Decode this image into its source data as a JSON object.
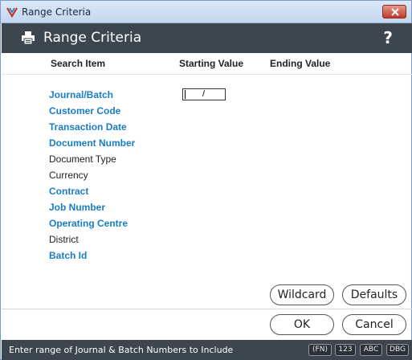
{
  "window": {
    "title": "Range Criteria"
  },
  "header": {
    "title": "Range Criteria",
    "help_glyph": "?"
  },
  "columns": {
    "search_item": "Search Item",
    "starting_value": "Starting Value",
    "ending_value": "Ending Value"
  },
  "fields": [
    {
      "label": "Journal/Batch",
      "link": true
    },
    {
      "label": "Customer Code",
      "link": true
    },
    {
      "label": "Transaction Date",
      "link": true
    },
    {
      "label": "Document Number",
      "link": true
    },
    {
      "label": "Document Type",
      "link": false
    },
    {
      "label": "Currency",
      "link": false
    },
    {
      "label": "Contract",
      "link": true
    },
    {
      "label": "Job Number",
      "link": true
    },
    {
      "label": "Operating Centre",
      "link": true
    },
    {
      "label": "District",
      "link": false
    },
    {
      "label": "Batch Id",
      "link": true
    }
  ],
  "journal_batch_input": {
    "separator": "/"
  },
  "buttons": {
    "wildcard": "Wildcard",
    "defaults": "Defaults",
    "ok": "OK",
    "cancel": "Cancel"
  },
  "status": {
    "message": "Enter range of Journal & Batch Numbers to Include",
    "badges": [
      "(FN)",
      "123",
      "ABC",
      "DBG"
    ]
  },
  "colors": {
    "link_blue": "#1a7dc4",
    "header_bg": "#3d454e",
    "close_red": "#c0392b"
  }
}
